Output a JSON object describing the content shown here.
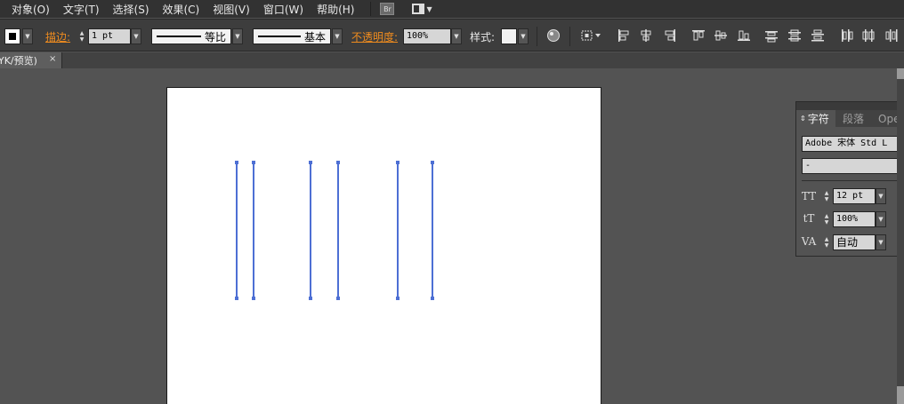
{
  "menu": {
    "items": [
      "对象(O)",
      "文字(T)",
      "选择(S)",
      "效果(C)",
      "视图(V)",
      "窗口(W)",
      "帮助(H)"
    ],
    "bridge_label": "Br"
  },
  "control": {
    "stroke_label": "描边:",
    "stroke_weight": "1 pt",
    "profile_label": "等比",
    "brush_label": "基本",
    "opacity_label": "不透明度:",
    "opacity_value": "100%",
    "style_label": "样式:",
    "fill_color": "#ffffff",
    "label_accent": "#f08c1e"
  },
  "document": {
    "tab_title": "YK/预览)",
    "close_glyph": "×"
  },
  "canvas": {
    "artboard_color": "#ffffff",
    "path_color": "#4d6fd4"
  },
  "character_panel": {
    "tabs": [
      "字符",
      "段落",
      "Oper"
    ],
    "font_family": "Adobe 宋体 Std L",
    "font_style": "-",
    "font_size": "12 pt",
    "leading": "100%",
    "kerning": "自动"
  }
}
